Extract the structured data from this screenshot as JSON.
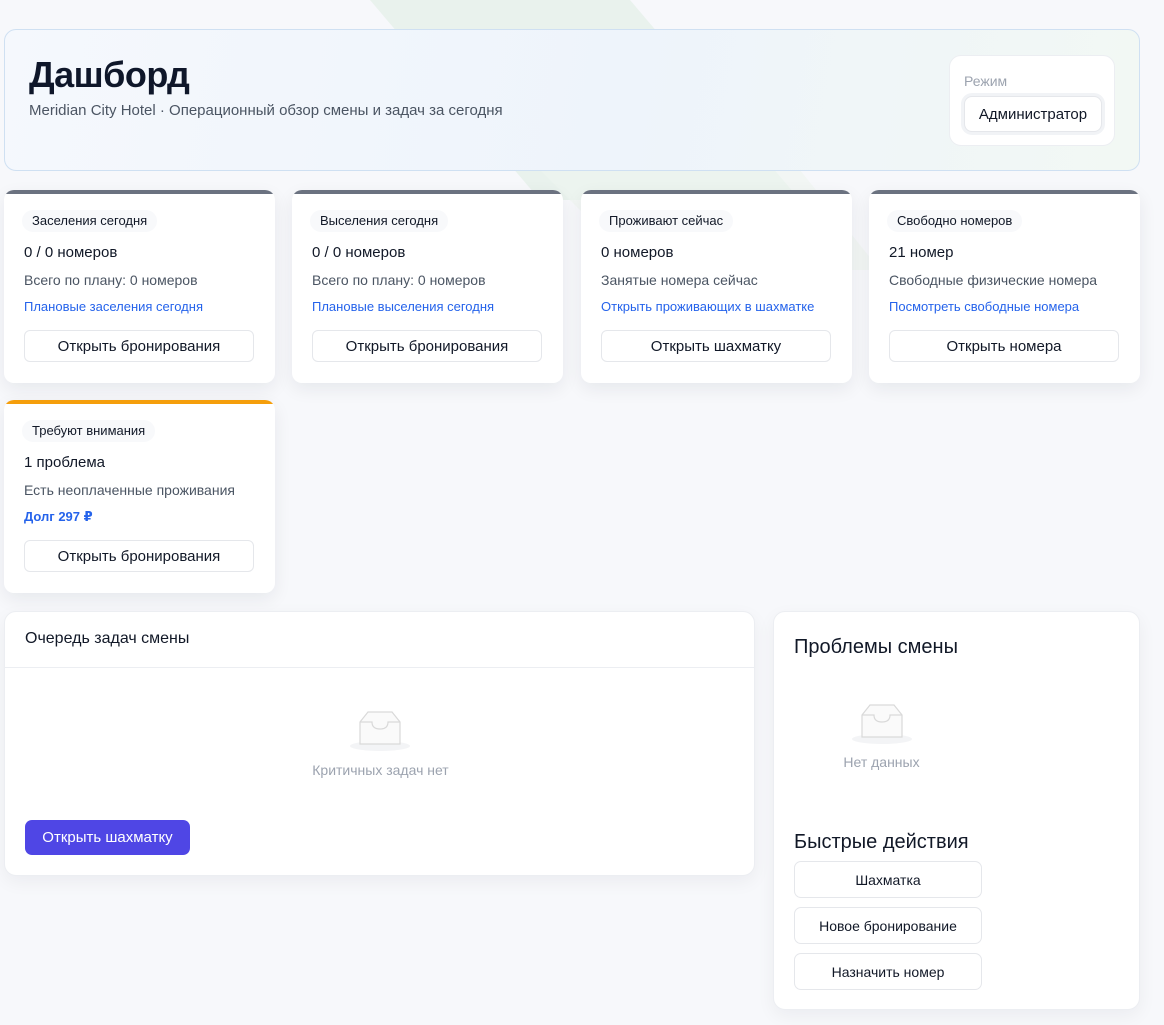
{
  "header": {
    "title": "Дашборд",
    "subtitle": "Meridian City Hotel · Операционный обзор смены и задач за сегодня",
    "mode_label": "Режим",
    "mode_value": "Администратор"
  },
  "cards": [
    {
      "tag": "Заселения сегодня",
      "value": "0 / 0 номеров",
      "desc": "Всего по плану: 0 номеров",
      "link": "Плановые заселения сегодня",
      "button": "Открыть бронирования",
      "accent": "#6b7280"
    },
    {
      "tag": "Выселения сегодня",
      "value": "0 / 0 номеров",
      "desc": "Всего по плану: 0 номеров",
      "link": "Плановые выселения сегодня",
      "button": "Открыть бронирования",
      "accent": "#6b7280"
    },
    {
      "tag": "Проживают сейчас",
      "value": "0 номеров",
      "desc": "Занятые номера сейчас",
      "link": "Открыть проживающих в шахматке",
      "button": "Открыть шахматку",
      "accent": "#6b7280"
    },
    {
      "tag": "Свободно номеров",
      "value": "21 номер",
      "desc": "Свободные физические номера",
      "link": "Посмотреть свободные номера",
      "button": "Открыть номера",
      "accent": "#6b7280"
    },
    {
      "tag": "Требуют внимания",
      "value": "1 проблема",
      "desc": "Есть неоплаченные проживания",
      "link": "Долг 297 ₽",
      "button": "Открыть бронирования",
      "accent": "#f59e0b"
    }
  ],
  "queue": {
    "title": "Очередь задач смены",
    "empty_text": "Критичных задач нет",
    "button": "Открыть шахматку"
  },
  "problems": {
    "title": "Проблемы смены",
    "empty_text": "Нет данных"
  },
  "quick_actions": {
    "title": "Быстрые действия",
    "items": [
      "Шахматка",
      "Новое бронирование",
      "Назначить номер"
    ]
  },
  "colors": {
    "primary": "#4f46e5",
    "link": "#2563eb",
    "neutral_accent": "#6b7280",
    "warning_accent": "#f59e0b"
  }
}
